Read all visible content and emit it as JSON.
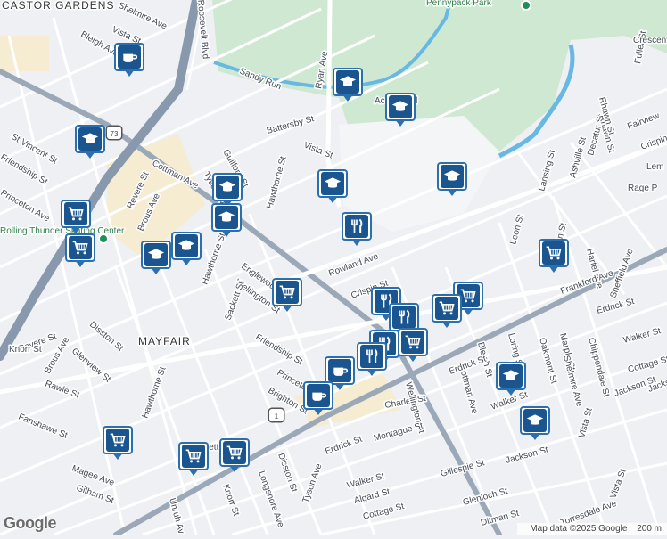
{
  "map": {
    "colors": {
      "background": "#eef0f3",
      "street": "#ffffff",
      "major_road": "#9aa8b8",
      "park": "#cfe8d1",
      "water": "#67b8e3",
      "commercial": "#f5ecd2",
      "marker_border": "#2b6fae",
      "marker_fill": "#1a5590"
    },
    "neighborhoods": [
      "CASTOR GARDENS",
      "MAYFAIR"
    ],
    "parks": [
      "Pennypack Park"
    ],
    "water": [
      "Sandy Run"
    ],
    "places": [
      "Rolling Thunder Skating Center",
      "Rage P"
    ],
    "highways": [
      "73",
      "1"
    ],
    "street_labels": [
      "Shelmire Ave",
      "Vista St",
      "Bleigh Ave",
      "Roosevelt Blvd",
      "Battersby St",
      "Ryan Ave",
      "Vista St",
      "Guilford St",
      "Tyson Ave",
      "Hawthorne St",
      "Cottman Ave",
      "Brous Ave",
      "Revere St",
      "St Vincent St",
      "Friendship St",
      "Princeton Ave",
      "Rowland Ave",
      "Crispin St",
      "Lansing St",
      "Ashville St",
      "Decatur St",
      "Rhawn St",
      "Fuller St",
      "Crescent",
      "Fairview",
      "Crispin",
      "Leon St",
      "Meridian St",
      "Hartel Ave",
      "Frankford Ave",
      "Sheffield Ave",
      "Erdrick St",
      "Walker St",
      "Cottage St",
      "Chippendale St",
      "Marple St",
      "Oakmont St",
      "Shelmire Ave",
      "Loring St",
      "Bleigh St",
      "Englewood St",
      "Wellington St",
      "Sackett St",
      "Hawthorne St",
      "Revere St",
      "Disston St",
      "Knorr St",
      "Glenview St",
      "Brous Ave",
      "Rawle St",
      "Fanshawe St",
      "Magee Ave",
      "Gilham St",
      "Friendship St",
      "Princeton Ave",
      "Brighton St",
      "Charles St",
      "Wellington St",
      "Montague St",
      "Erdrick St",
      "Tyson Ave",
      "Walker St",
      "Algard St",
      "Cottage St",
      "Gillespie St",
      "Glenloch St",
      "Ditman St",
      "Torresdale Ave",
      "Vista St",
      "Jackson St",
      "Disston St",
      "Longshore Ave",
      "Knorr St",
      "Unruh Av",
      "Cottman Ave",
      "Erdrick St",
      "Walker St",
      "Jackson St",
      "Vista St",
      "Jackson",
      "Sackett St",
      "Hawthorne St",
      "Lem",
      "Rhawn St"
    ],
    "school_label": "Acc school",
    "markers": [
      {
        "type": "cafe-icon"
      },
      {
        "type": "school-icon"
      },
      {
        "type": "school-icon"
      },
      {
        "type": "school-icon"
      },
      {
        "type": "school-icon"
      },
      {
        "type": "school-icon"
      },
      {
        "type": "school-icon"
      },
      {
        "type": "school-icon"
      },
      {
        "type": "school-icon"
      },
      {
        "type": "school-icon"
      },
      {
        "type": "grocery-cart-icon"
      },
      {
        "type": "grocery-cart-icon"
      },
      {
        "type": "restaurant-icon"
      },
      {
        "type": "grocery-cart-icon"
      },
      {
        "type": "grocery-cart-icon"
      },
      {
        "type": "school-icon"
      },
      {
        "type": "school-icon"
      },
      {
        "type": "cafe-icon"
      },
      {
        "type": "cafe-icon"
      },
      {
        "type": "grocery-cart-icon"
      },
      {
        "type": "grocery-cart-icon"
      },
      {
        "type": "grocery-cart-icon"
      },
      {
        "type": "restaurant-icon"
      },
      {
        "type": "grocery-cart-icon"
      },
      {
        "type": "restaurant-icon"
      },
      {
        "type": "grocery-cart-icon"
      },
      {
        "type": "restaurant-icon"
      },
      {
        "type": "grocery-cart-icon"
      },
      {
        "type": "restaurant-icon"
      }
    ]
  },
  "footer": {
    "map_data": "Map data ©2025 Google",
    "scale": "200 m",
    "google_logo": "Google"
  }
}
